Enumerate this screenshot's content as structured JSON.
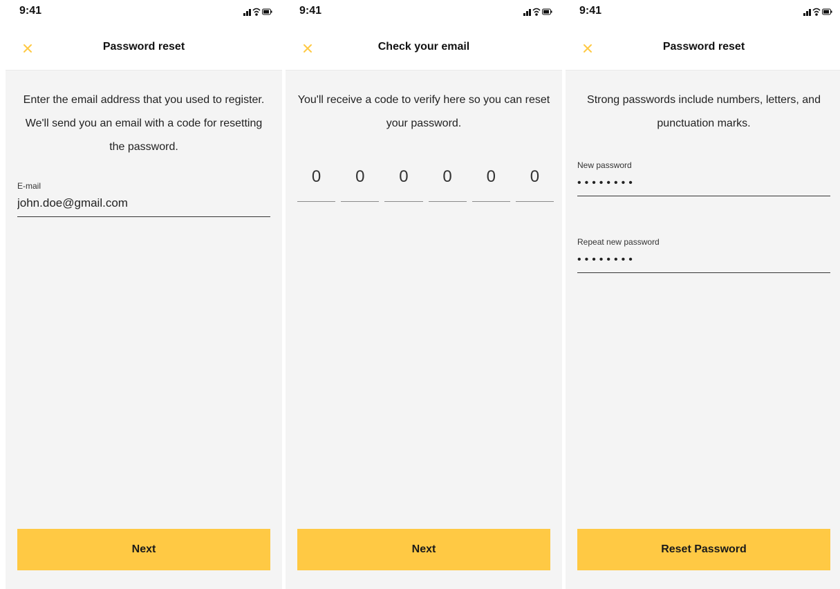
{
  "colors": {
    "accent": "#ffc944",
    "background": "#f4f4f4"
  },
  "screens": [
    {
      "status": {
        "time": "9:41"
      },
      "title": "Password reset",
      "description": "Enter the email address that you used to register. We'll send you an email with a code for resetting the password.",
      "email": {
        "label": "E-mail",
        "value": "john.doe@gmail.com"
      },
      "button": "Next"
    },
    {
      "status": {
        "time": "9:41"
      },
      "title": "Check your email",
      "description": "You'll receive a code to verify here so you can reset your password.",
      "code": [
        "0",
        "0",
        "0",
        "0",
        "0",
        "0"
      ],
      "button": "Next"
    },
    {
      "status": {
        "time": "9:41"
      },
      "title": "Password reset",
      "description": "Strong passwords include numbers, letters, and punctuation marks.",
      "new_password": {
        "label": "New password",
        "value": "••••••••"
      },
      "repeat_password": {
        "label": "Repeat new password",
        "value": "••••••••"
      },
      "button": "Reset Password"
    }
  ],
  "icons": {
    "close": "close-icon",
    "signal": "signal-icon",
    "wifi": "wifi-icon",
    "battery": "battery-icon"
  }
}
